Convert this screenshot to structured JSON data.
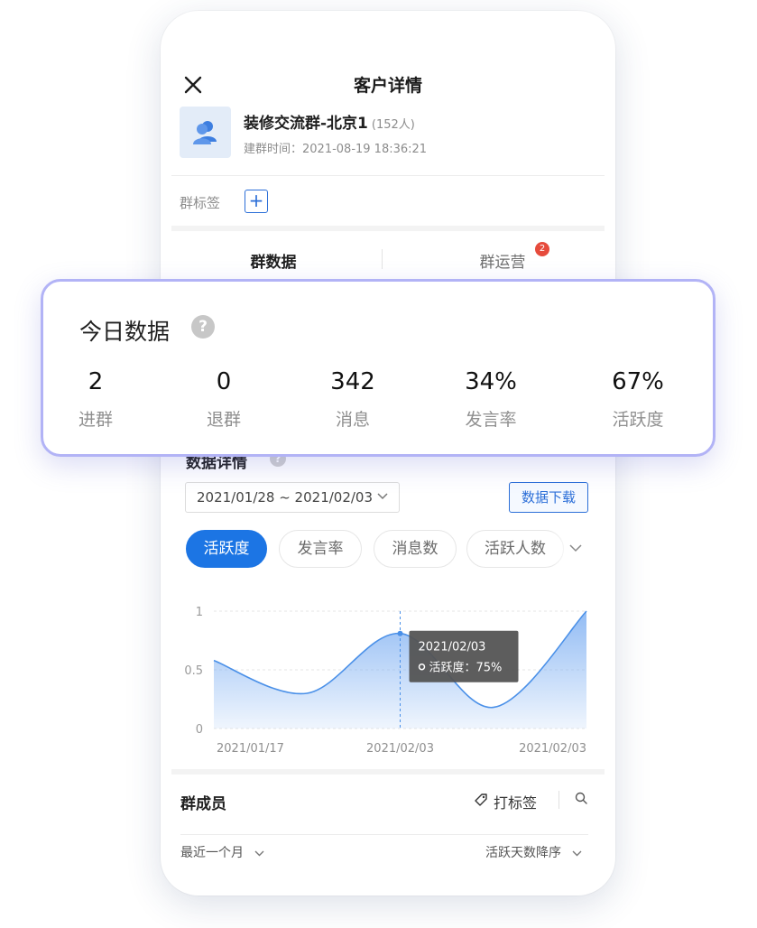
{
  "header": {
    "title": "客户详情"
  },
  "group": {
    "name": "装修交流群-北京1",
    "member_count": "(152人)",
    "created": "建群时间：2021-08-19 18:36:21"
  },
  "tags": {
    "label": "群标签",
    "add_symbol": "+"
  },
  "tabs": [
    {
      "label": "群数据",
      "active": true
    },
    {
      "label": "群运营",
      "badge": "2"
    }
  ],
  "today": {
    "title": "今日数据",
    "help_symbol": "?",
    "stats": [
      {
        "value": "2",
        "label": "进群"
      },
      {
        "value": "0",
        "label": "退群"
      },
      {
        "value": "342",
        "label": "消息"
      },
      {
        "value": "34%",
        "label": "发言率"
      },
      {
        "value": "67%",
        "label": "活跃度"
      }
    ]
  },
  "details": {
    "title": "数据详情",
    "help_symbol": "?",
    "date_range": "2021/01/28 ~ 2021/02/03",
    "download_label": "数据下载",
    "chips": [
      {
        "label": "活跃度",
        "active": true
      },
      {
        "label": "发言率",
        "active": false
      },
      {
        "label": "消息数",
        "active": false
      },
      {
        "label": "活跃人数",
        "active": false
      }
    ]
  },
  "chart_data": {
    "type": "area",
    "x": [
      "2021/01/17",
      "2021/02/03",
      "2021/02/03"
    ],
    "y_ticks": [
      "1",
      "0.5",
      "0"
    ],
    "ylim": [
      0,
      1
    ],
    "series": [
      {
        "points": [
          [
            0,
            0.58
          ],
          [
            0.25,
            0.3
          ],
          [
            0.5,
            0.81
          ],
          [
            0.75,
            0.18
          ],
          [
            1.0,
            1.0
          ]
        ]
      }
    ],
    "tooltip": {
      "date": "2021/02/03",
      "label": "活跃度：75%",
      "at": 0.5
    },
    "colors": {
      "line": "#4a90e8",
      "fill_top": "#7fb0f2",
      "grid": "#e5e5e5",
      "tooltip_bg": "#545454"
    }
  },
  "members": {
    "title": "群成员",
    "tag_action": "打标签",
    "filter_left": "最近一个月",
    "filter_right": "活跃天数降序"
  },
  "colors": {
    "primary": "#1c75e4",
    "badge": "#e64b3c",
    "card_border": "#b2b3f6"
  }
}
